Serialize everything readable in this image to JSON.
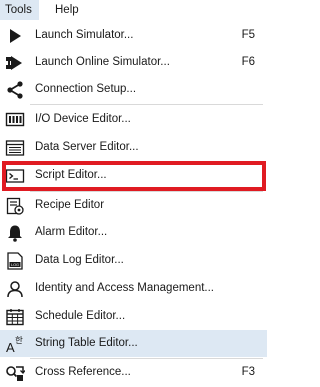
{
  "menubar": {
    "tools": "Tools",
    "help": "Help"
  },
  "menu": {
    "items": [
      {
        "label": "Launch Simulator...",
        "shortcut": "F5",
        "icon": "play-icon"
      },
      {
        "label": "Launch Online Simulator...",
        "shortcut": "F6",
        "icon": "online-play-icon"
      },
      {
        "label": "Connection Setup...",
        "shortcut": "",
        "icon": "share-icon"
      },
      {
        "label": "I/O Device Editor...",
        "shortcut": "",
        "icon": "io-device-icon"
      },
      {
        "label": "Data Server Editor...",
        "shortcut": "",
        "icon": "data-server-icon"
      },
      {
        "label": "Script Editor...",
        "shortcut": "",
        "icon": "script-icon"
      },
      {
        "label": "Recipe Editor",
        "shortcut": "",
        "icon": "recipe-icon"
      },
      {
        "label": "Alarm Editor...",
        "shortcut": "",
        "icon": "bell-icon"
      },
      {
        "label": "Data Log Editor...",
        "shortcut": "",
        "icon": "data-log-icon"
      },
      {
        "label": "Identity and Access Management...",
        "shortcut": "",
        "icon": "user-icon"
      },
      {
        "label": "Schedule Editor...",
        "shortcut": "",
        "icon": "calendar-icon"
      },
      {
        "label": "String Table Editor...",
        "shortcut": "",
        "icon": "string-table-icon"
      },
      {
        "label": "Cross Reference...",
        "shortcut": "F3",
        "icon": "cross-reference-icon"
      }
    ]
  },
  "colors": {
    "highlight": "#dde8f3",
    "annotation_box": "#e01b22"
  }
}
